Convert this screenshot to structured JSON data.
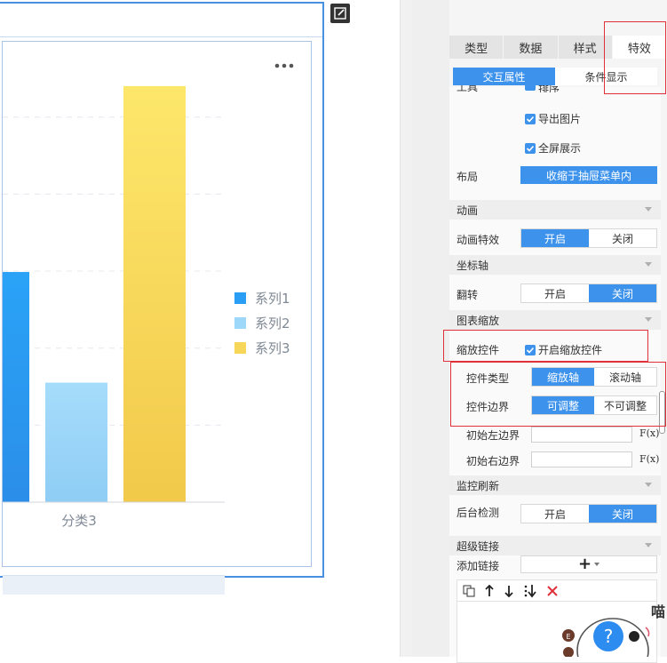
{
  "tabs": [
    "类型",
    "数据",
    "样式",
    "特效"
  ],
  "active_tab": "特效",
  "subtabs": [
    "交互属性",
    "条件显示"
  ],
  "active_subtab": "交互属性",
  "clipped_label": "工具",
  "clipped_option": "排序",
  "checks": {
    "export_image": "导出图片",
    "fullscreen": "全屏展示"
  },
  "layout": {
    "label": "布局",
    "value": "收缩于抽屉菜单内"
  },
  "sections": {
    "animation": "动画",
    "axis": "坐标轴",
    "zoom": "图表缩放",
    "monitor": "监控刷新",
    "hyperlink": "超级链接"
  },
  "animation_effect": {
    "label": "动画特效",
    "on": "开启",
    "off": "关闭",
    "selected": "开启"
  },
  "flip": {
    "label": "翻转",
    "on": "开启",
    "off": "关闭",
    "selected": "关闭"
  },
  "zoom_control": {
    "label": "缩放控件",
    "check": "开启缩放控件"
  },
  "control_type": {
    "label": "控件类型",
    "a": "缩放轴",
    "b": "滚动轴",
    "selected": "缩放轴"
  },
  "control_boundary": {
    "label": "控件边界",
    "a": "可调整",
    "b": "不可调整",
    "selected": "可调整"
  },
  "init_left": {
    "label": "初始左边界",
    "fx": "F(x)"
  },
  "init_right": {
    "label": "初始右边界",
    "fx": "F(x)"
  },
  "backend_check": {
    "label": "后台检测",
    "on": "开启",
    "off": "关闭",
    "selected": "关闭"
  },
  "add_link": {
    "label": "添加链接",
    "plus": "+"
  },
  "chart_data": {
    "type": "bar",
    "categories": [
      "分类3"
    ],
    "series": [
      {
        "name": "系列1",
        "values": [
          0.52
        ],
        "color": "#2a9df4"
      },
      {
        "name": "系列2",
        "values": [
          0.27
        ],
        "color": "#9dd8fa"
      },
      {
        "name": "系列3",
        "values": [
          0.94
        ],
        "color": "#f7d75a"
      }
    ],
    "ylim": [
      0,
      1
    ],
    "grid": true,
    "legend_position": "right"
  },
  "colors": {
    "accent": "#3d92ec",
    "highlight": "#e0303a"
  },
  "help_label": "?",
  "mascot_text": "喵"
}
